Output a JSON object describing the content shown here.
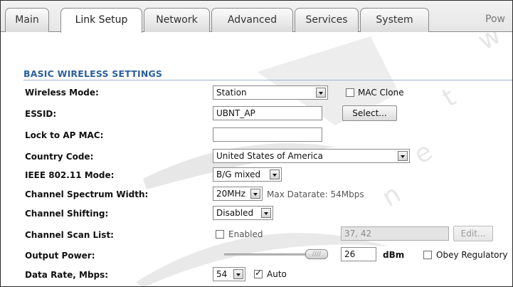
{
  "tabs": [
    "Main",
    "Link Setup",
    "Network",
    "Advanced",
    "Services",
    "System",
    "Pow"
  ],
  "active_tab": "Link Setup",
  "section_title": "BASIC WIRELESS SETTINGS",
  "fields": {
    "wireless_mode": {
      "label": "Wireless Mode:",
      "value": "Station",
      "mac_clone_label": "MAC Clone"
    },
    "essid": {
      "label": "ESSID:",
      "value": "UBNT_AP",
      "select_button": "Select..."
    },
    "lock_ap_mac": {
      "label": "Lock to AP MAC:",
      "value": ""
    },
    "country_code": {
      "label": "Country Code:",
      "value": "United States of America"
    },
    "ieee_mode": {
      "label": "IEEE 802.11 Mode:",
      "value": "B/G mixed"
    },
    "channel_width": {
      "label": "Channel Spectrum Width:",
      "value": "20MHz",
      "max_datarate": "Max Datarate: 54Mbps"
    },
    "channel_shifting": {
      "label": "Channel Shifting:",
      "value": "Disabled"
    },
    "channel_scan_list": {
      "label": "Channel Scan List:",
      "enabled_label": "Enabled",
      "value": "37, 42",
      "edit_button": "Edit..."
    },
    "output_power": {
      "label": "Output Power:",
      "value": "26",
      "unit": "dBm",
      "obey_label": "Obey Regulatory"
    },
    "data_rate": {
      "label": "Data Rate, Mbps:",
      "value": "54",
      "auto_label": "Auto"
    }
  },
  "checkboxes": {
    "mac_clone": false,
    "scan_enabled": false,
    "obey_regulatory": false,
    "auto": true
  },
  "colors": {
    "section_title": "#2c5f9a",
    "watermark": "#e6e6e6"
  }
}
